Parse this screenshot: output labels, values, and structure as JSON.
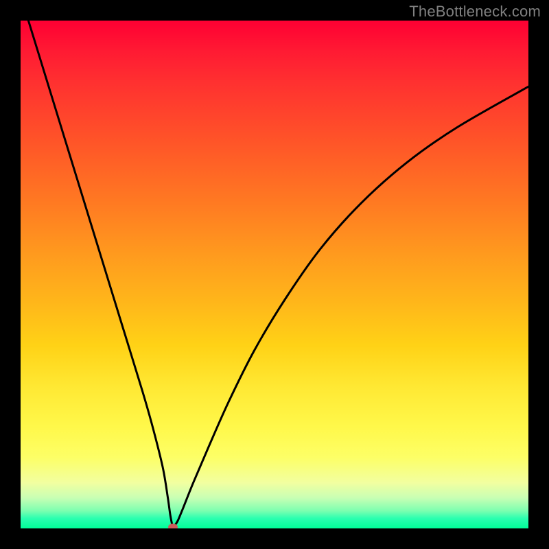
{
  "watermark": "TheBottleneck.com",
  "colors": {
    "frame": "#000000",
    "curve": "#000000",
    "marker": "#cd5c5c"
  },
  "chart_data": {
    "type": "line",
    "title": "",
    "xlabel": "",
    "ylabel": "",
    "xlim": [
      0,
      100
    ],
    "ylim": [
      0,
      100
    ],
    "grid": false,
    "legend": false,
    "gradient_stops": [
      {
        "pos": 0,
        "color": "#ff0033"
      },
      {
        "pos": 0.24,
        "color": "#ff5528"
      },
      {
        "pos": 0.46,
        "color": "#ff9a1e"
      },
      {
        "pos": 0.72,
        "color": "#ffe833"
      },
      {
        "pos": 0.91,
        "color": "#f2ffa0"
      },
      {
        "pos": 1.0,
        "color": "#00ff99"
      }
    ],
    "series": [
      {
        "name": "bottleneck-curve",
        "x": [
          0,
          4,
          8,
          12,
          16,
          20,
          24,
          26,
          28,
          29,
          29.5,
          30,
          30.5,
          31,
          32,
          34,
          37,
          41,
          46,
          52,
          59,
          67,
          76,
          86,
          100
        ],
        "y": [
          105,
          92,
          79,
          66,
          53,
          40,
          27,
          20,
          12,
          6,
          2.5,
          0.3,
          0.8,
          1.6,
          4,
          9,
          16,
          25,
          35,
          45,
          55,
          64,
          72,
          79,
          87
        ]
      }
    ],
    "marker": {
      "x": 30,
      "y": 0.3
    }
  }
}
